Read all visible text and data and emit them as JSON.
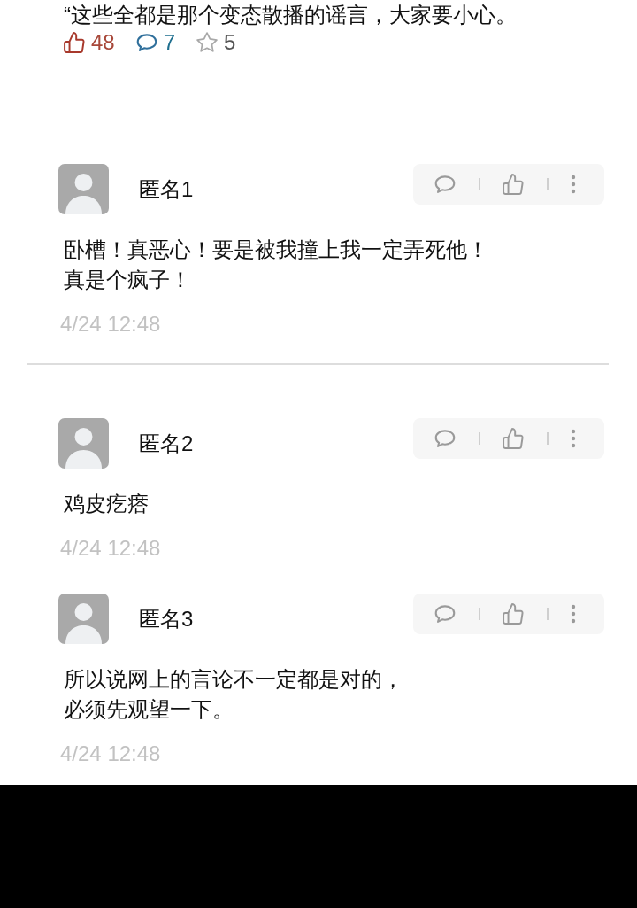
{
  "post": {
    "text": "“这些全都是那个变态散播的谣言，大家要小心。",
    "stats": [
      {
        "kind": "likes",
        "count": "48"
      },
      {
        "kind": "comments",
        "count": "7"
      },
      {
        "kind": "favorites",
        "count": "5"
      }
    ]
  },
  "comments": [
    {
      "name": "匿名1",
      "lines": [
        "卧槽！真恶心！要是被我撞上我一定弄死他！",
        "真是个疯子！"
      ],
      "time": "4/24 12:48",
      "separated": true
    },
    {
      "name": "匿名2",
      "lines": [
        "鸡皮疙瘩"
      ],
      "time": "4/24 12:48",
      "separated": false
    },
    {
      "name": "匿名3",
      "lines": [
        "所以说网上的言论不一定都是对的，",
        "必须先观望一下。"
      ],
      "time": "4/24 12:48",
      "separated": false
    }
  ]
}
